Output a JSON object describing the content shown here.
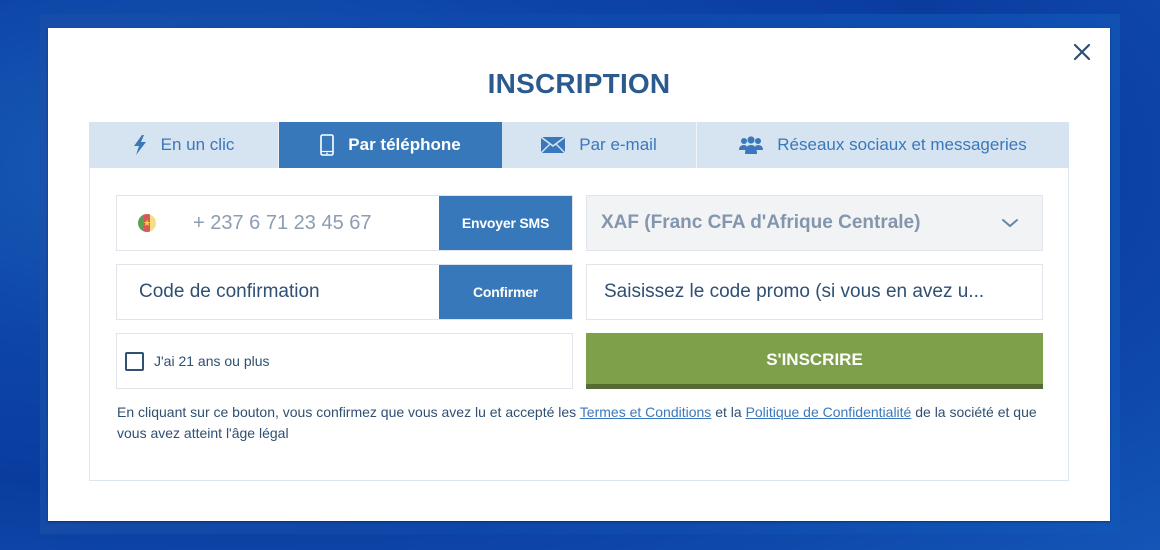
{
  "modal": {
    "title": "INSCRIPTION",
    "close_icon": "close-icon"
  },
  "tabs": [
    {
      "label": "En un clic",
      "icon": "lightning-icon",
      "active": false
    },
    {
      "label": "Par téléphone",
      "icon": "smartphone-icon",
      "active": true
    },
    {
      "label": "Par e-mail",
      "icon": "envelope-icon",
      "active": false
    },
    {
      "label": "Réseaux sociaux et messageries",
      "icon": "users-icon",
      "active": false
    }
  ],
  "form": {
    "phone": {
      "country_flag": "cameroon-flag-icon",
      "value": "+ 237 6 71 23 45 67",
      "button_label": "Envoyer SMS"
    },
    "currency": {
      "selected": "XAF (Franc CFA d'Afrique Centrale)",
      "icon": "chevron-down-icon"
    },
    "confirmation": {
      "placeholder": "Code de confirmation",
      "button_label": "Confirmer"
    },
    "promo": {
      "placeholder": "Saisissez le code promo (si vous en avez u..."
    },
    "age_check": {
      "label": "J'ai 21 ans ou plus",
      "checked": false
    },
    "submit_label": "S'INSCRIRE"
  },
  "legal": {
    "text_before": "En cliquant sur ce bouton, vous confirmez que vous avez lu et accepté les ",
    "terms_link": "Termes et Conditions",
    "text_middle": " et la ",
    "privacy_link": "Politique de Confidentialité",
    "text_after": " de la société et que vous avez atteint l'âge légal"
  },
  "colors": {
    "primary_blue": "#3778ba",
    "title_blue": "#2b5b8e",
    "tab_bg": "#d6e4f1",
    "submit_green": "#7ea04a",
    "text_dark": "#2f4f73"
  }
}
